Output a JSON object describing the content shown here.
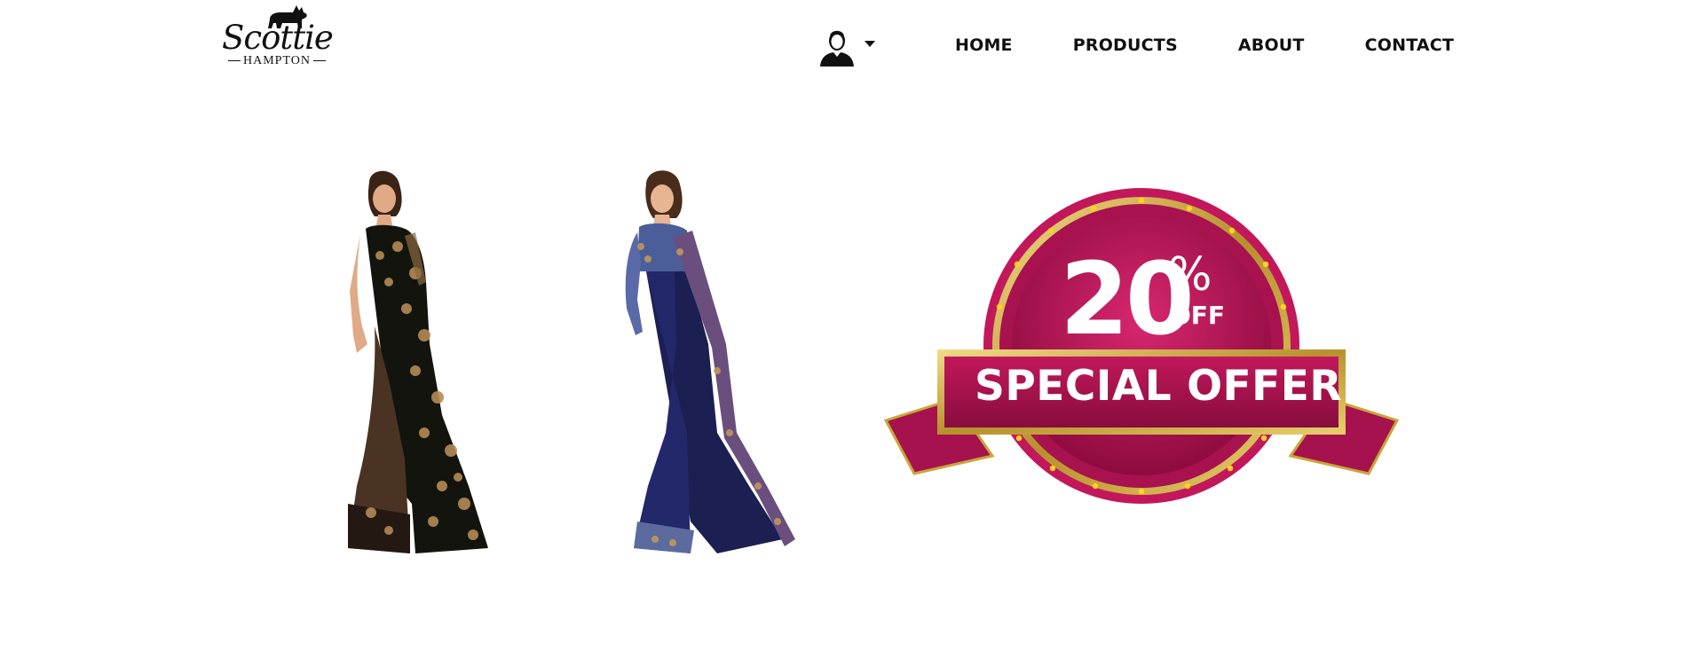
{
  "brand": {
    "name": "Scottie",
    "tagline": "HAMPTON"
  },
  "header": {
    "user_icon": "user-avatar-icon",
    "dropdown_icon": "caret-down-icon",
    "nav": [
      {
        "label": "HOME"
      },
      {
        "label": "PRODUCTS"
      },
      {
        "label": "ABOUT"
      },
      {
        "label": "CONTACT"
      }
    ]
  },
  "products": [
    {
      "image": "saree-black-gold"
    },
    {
      "image": "saree-navy-printed"
    }
  ],
  "offer": {
    "percent": "20",
    "percent_sign": "%",
    "off": "OFF",
    "headline": "SPECIAL OFFER",
    "colors": {
      "primary": "#a8124e",
      "gold": "#c9a73a"
    }
  }
}
